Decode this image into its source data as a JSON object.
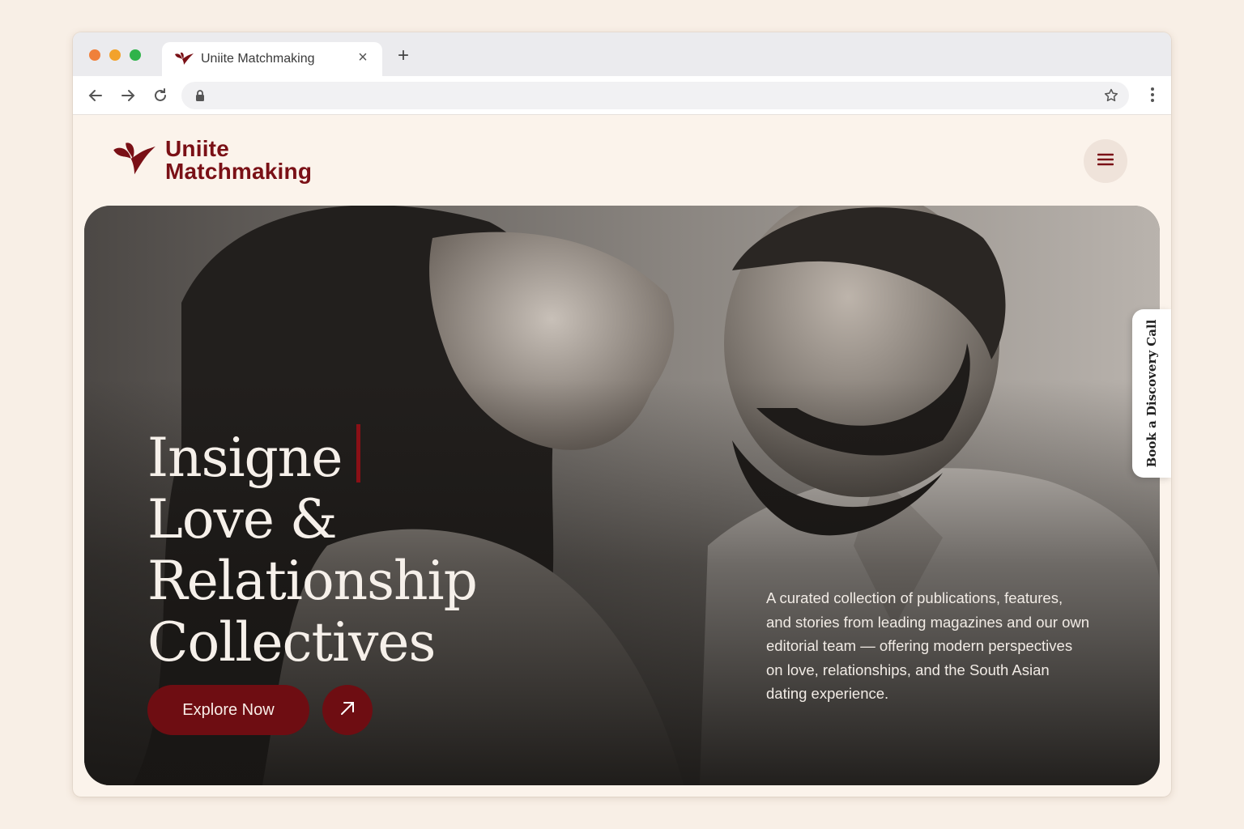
{
  "browser": {
    "tab_title": "Uniite Matchmaking",
    "tab_close": "×",
    "new_tab": "+",
    "url": ""
  },
  "header": {
    "logo_line1": "Uniite",
    "logo_line2": "Matchmaking"
  },
  "hero": {
    "headline_lines": [
      "Insigne",
      "Love &",
      "Relationship",
      "Collectives"
    ],
    "cta_label": "Explore Now",
    "description": "A curated collection of publications, features, and stories from leading magazines and our own editorial team — offering modern perspectives on love, relationships, and the South Asian dating experience.",
    "side_tab_label": "Book a Discovery Call"
  },
  "icons": {
    "tab": "bird-logo-icon",
    "back": "arrow-left-icon",
    "forward": "arrow-right-icon",
    "reload": "reload-icon",
    "lock": "lock-icon",
    "bookmark": "star-icon",
    "browser_menu": "kebab-menu-icon",
    "site_menu": "hamburger-menu-icon",
    "cta_arrow": "arrow-up-right-icon"
  },
  "colors": {
    "brand": "#7a1016",
    "button": "#6e0d12",
    "page_bg": "#fbf3eb",
    "outer_bg": "#f8efe6"
  }
}
